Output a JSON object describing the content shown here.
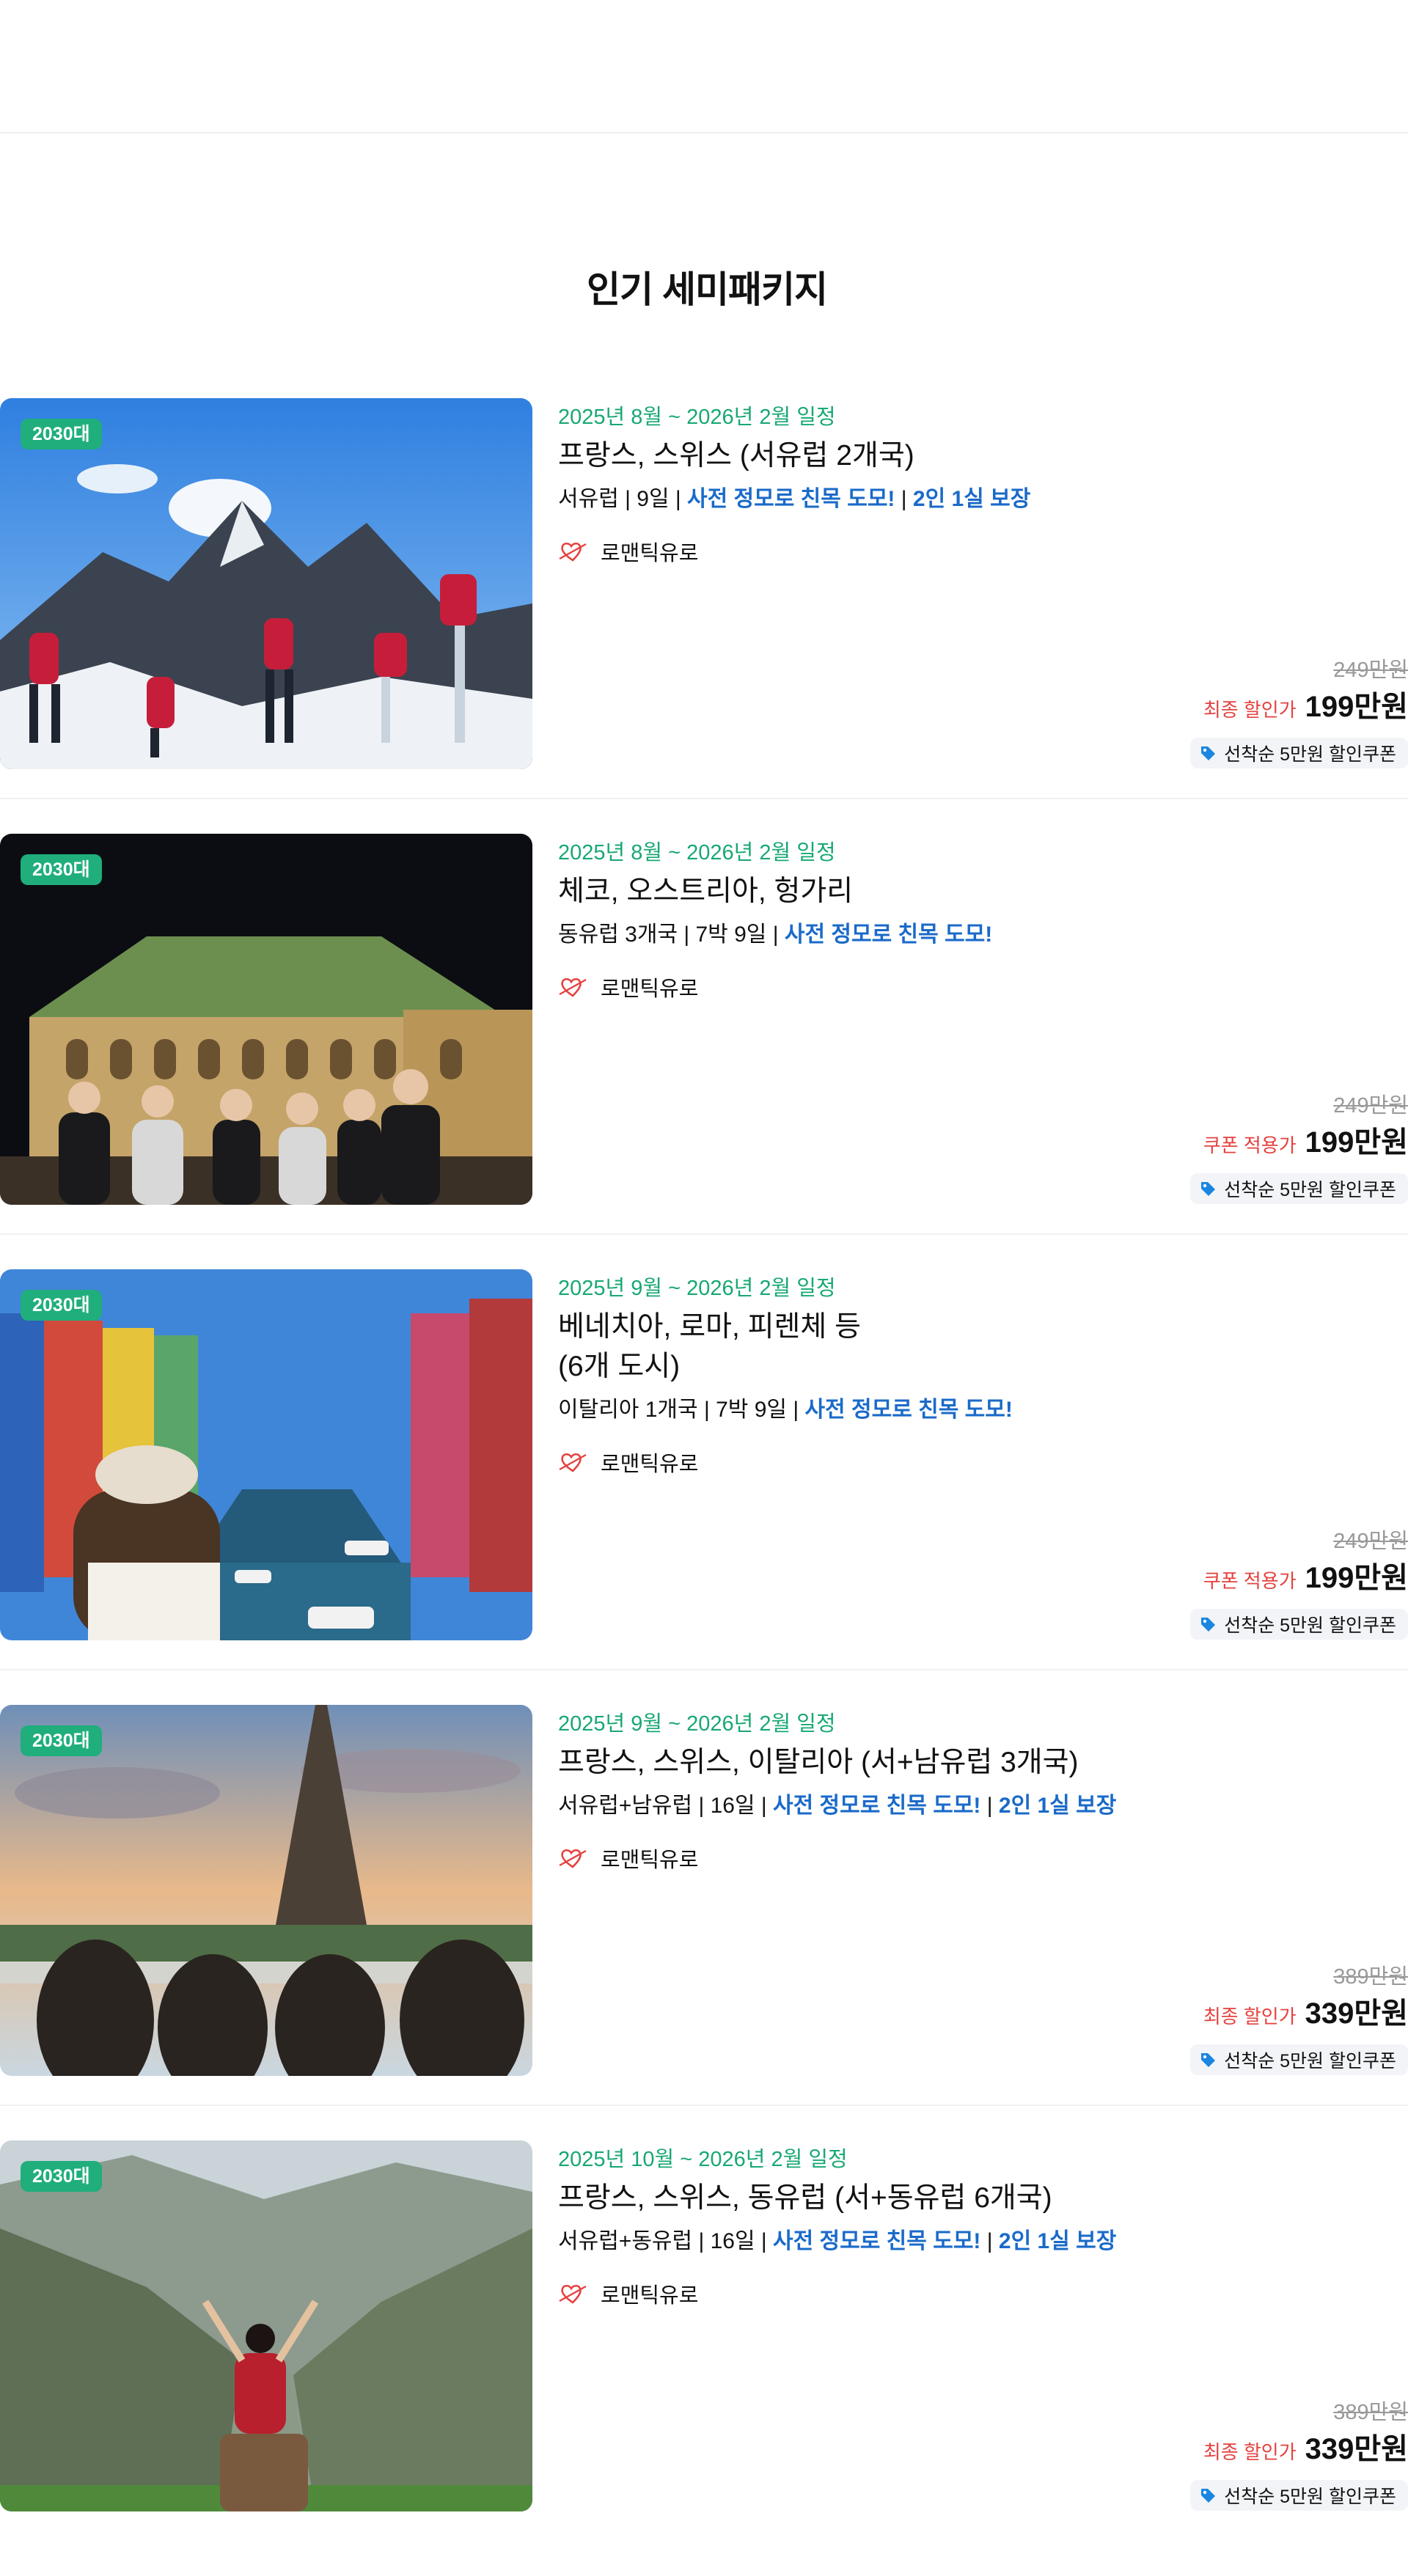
{
  "section": {
    "title": "인기 세미패키지"
  },
  "packages": [
    {
      "badge": "2030대",
      "date": "2025년 8월 ~ 2026년 2월 일정",
      "title_lines": [
        "프랑스, 스위스 (서유럽 2개국)"
      ],
      "meta": {
        "base": "서유럽 | 9일 | ",
        "highlights": [
          "사전 정모로 친목 도모!",
          "2인 1실 보장"
        ]
      },
      "brand": "로맨틱유로",
      "original_price": "249만원",
      "price_label": "최종 할인가",
      "price": "199만원",
      "coupon": "선착순 5만원 할인쿠폰",
      "photo": "mountain-jump-scene"
    },
    {
      "badge": "2030대",
      "date": "2025년 8월 ~ 2026년 2월 일정",
      "title_lines": [
        "체코, 오스트리아, 헝가리"
      ],
      "meta": {
        "base": "동유럽 3개국 | 7박 9일 | ",
        "highlights": [
          "사전 정모로 친목 도모!"
        ]
      },
      "brand": "로맨틱유로",
      "original_price": "249만원",
      "price_label": "쿠폰 적용가",
      "price": "199만원",
      "coupon": "선착순 5만원 할인쿠폰",
      "photo": "opera-house-night-scene"
    },
    {
      "badge": "2030대",
      "date": "2025년 9월 ~ 2026년 2월 일정",
      "title_lines": [
        "베네치아, 로마, 피렌체 등",
        "(6개 도시)"
      ],
      "meta": {
        "base": "이탈리아 1개국 | 7박 9일 | ",
        "highlights": [
          "사전 정모로 친목 도모!"
        ]
      },
      "brand": "로맨틱유로",
      "original_price": "249만원",
      "price_label": "쿠폰 적용가",
      "price": "199만원",
      "coupon": "선착순 5만원 할인쿠폰",
      "photo": "canal-village-scene"
    },
    {
      "badge": "2030대",
      "date": "2025년 9월 ~ 2026년 2월 일정",
      "title_lines": [
        "프랑스, 스위스, 이탈리아 (서+남유럽 3개국)"
      ],
      "meta": {
        "base": "서유럽+남유럽 | 16일 | ",
        "highlights": [
          "사전 정모로 친목 도모!",
          "2인 1실 보장"
        ]
      },
      "brand": "로맨틱유로",
      "original_price": "389만원",
      "price_label": "최종 할인가",
      "price": "339만원",
      "coupon": "선착순 5만원 할인쿠폰",
      "photo": "eiffel-tower-scene"
    },
    {
      "badge": "2030대",
      "date": "2025년 10월 ~ 2026년 2월 일정",
      "title_lines": [
        "프랑스, 스위스, 동유럽 (서+동유럽 6개국)"
      ],
      "meta": {
        "base": "서유럽+동유럽 | 16일 | ",
        "highlights": [
          "사전 정모로 친목 도모!",
          "2인 1실 보장"
        ]
      },
      "brand": "로맨틱유로",
      "original_price": "389만원",
      "price_label": "최종 할인가",
      "price": "339만원",
      "coupon": "선착순 5만원 할인쿠폰",
      "photo": "alpine-valley-scene"
    }
  ]
}
